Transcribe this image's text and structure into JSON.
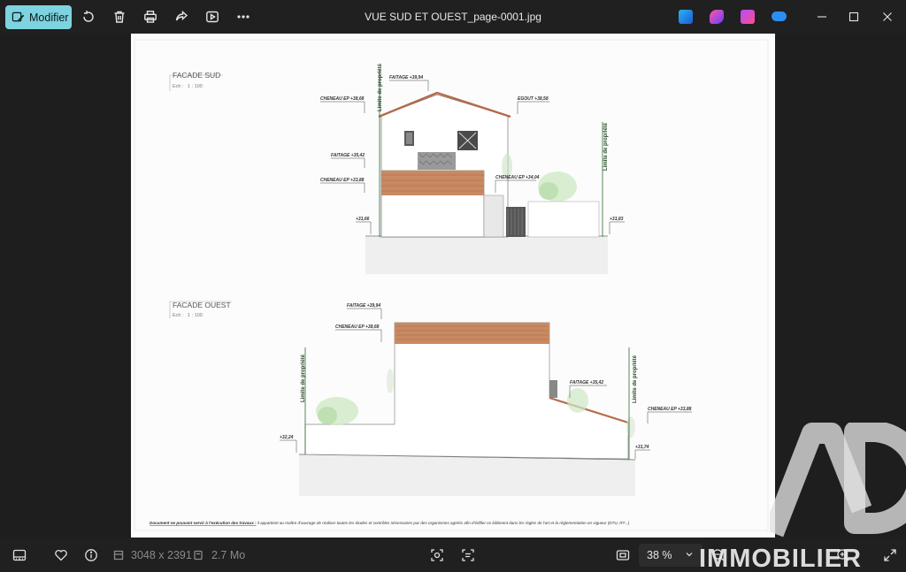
{
  "toolbar": {
    "edit_label": "Modifier",
    "icons": [
      "rotate-icon",
      "delete-icon",
      "print-icon",
      "share-icon",
      "slideshow-icon",
      "more-icon"
    ]
  },
  "window": {
    "title": "VUE SUD ET OUEST_page-0001.jpg"
  },
  "drawing": {
    "south": {
      "title": "FACADE SUD",
      "scale_prefix": "Ech :",
      "scale": "1 : 100",
      "labels": {
        "faitage_top": "FAITAGE +39,94",
        "cheneau_top": "CHENEAU EP +38,68",
        "egout": "EGOUT +38,58",
        "faitage_mid": "FAITAGE +35,42",
        "cheneau_mid": "CHENEAU EP +33,88",
        "cheneau_right": "CHENEAU EP +34,04",
        "level_left": "+31,66",
        "level_right": "+31,83"
      },
      "limit_left": "Limite de propriété",
      "limit_right": "Limite de propriété"
    },
    "west": {
      "title": "FACADE OUEST",
      "scale_prefix": "Ech :",
      "scale": "1 : 100",
      "labels": {
        "faitage_top": "FAITAGE +39,94",
        "cheneau_top": "CHENEAU EP +38,68",
        "faitage_mid": "FAITAGE +35,42",
        "cheneau_right": "CHENEAU EP +33,88",
        "level_left": "+32,24",
        "level_right": "+31,74"
      },
      "limit_left": "Limite de propriété",
      "limit_right": "Limite de propriété"
    },
    "note_underlined": "Document ne pouvant servir à l'exécution des travaux :",
    "note_rest": " il appartient au maître d'ouvrage de réaliser toutes les études et contrôles nécessaires par des organismes agréés afin d'édifier ce bâtiment dans les règles de l'art et la réglementation en vigueur (DTU, RT...)"
  },
  "watermark": {
    "text": "IMMOBILIER"
  },
  "statusbar": {
    "dimensions": "3048 x 2391",
    "file_size": "2.7 Mo",
    "zoom": "38 %"
  },
  "colors": {
    "edit_button": "#7dd3e0",
    "background": "#202020",
    "roof_tile": "#c98a62"
  }
}
